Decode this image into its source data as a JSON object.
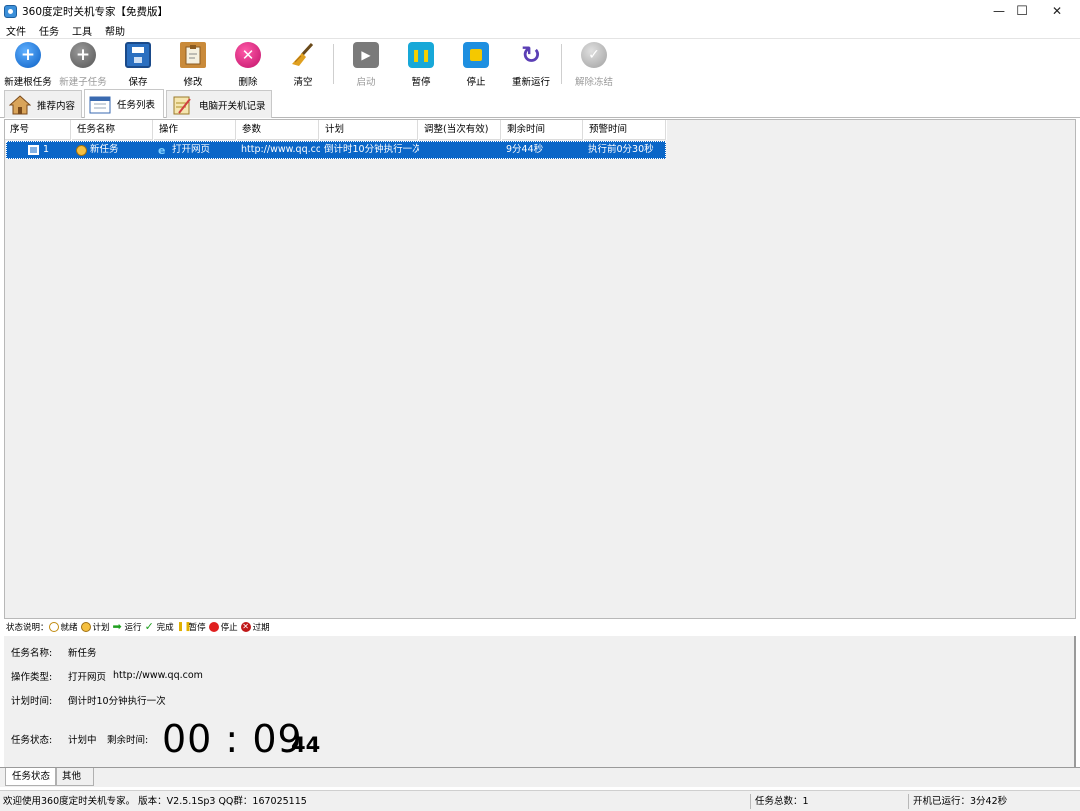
{
  "window": {
    "title": "360度定时关机专家【免费版】",
    "minimize": "—",
    "maximize": "☐",
    "close": "✕"
  },
  "menu": [
    "文件",
    "任务",
    "工具",
    "帮助"
  ],
  "toolbar": {
    "new_root_task": "新建根任务",
    "new_sub_task": "新建子任务",
    "save": "保存",
    "edit": "修改",
    "delete": "删除",
    "clear": "清空",
    "start": "启动",
    "pause": "暂停",
    "stop": "停止",
    "rerun": "重新运行",
    "unfreeze": "解除冻结"
  },
  "tabs": [
    "推荐内容",
    "任务列表",
    "电脑开关机记录"
  ],
  "grid": {
    "columns": [
      "序号",
      "任务名称",
      "操作",
      "参数",
      "计划",
      "调整(当次有效)",
      "剩余时间",
      "预警时间"
    ],
    "rows": [
      {
        "index": "1",
        "name": "新任务",
        "action": "打开网页",
        "param": "http://www.qq.com",
        "plan": "倒计时10分钟执行一次",
        "adjust": "",
        "remaining": "9分44秒",
        "warning": "执行前0分30秒"
      }
    ]
  },
  "legend": {
    "title": "状态说明：",
    "items": [
      "就绪",
      "计划",
      "运行",
      "完成",
      "暂停",
      "停止",
      "过期"
    ]
  },
  "details": {
    "name_label": "任务名称:",
    "name_value": "新任务",
    "type_label": "操作类型:",
    "type_value": "打开网页",
    "type_param": "http://www.qq.com",
    "plan_label": "计划时间:",
    "plan_value": "倒计时10分钟执行一次",
    "status_label": "任务状态:",
    "status_value": "计划中",
    "remaining_label": "剩余时间:",
    "clock": "00 : 09",
    "seconds": "44"
  },
  "bottom_tabs": [
    "任务状态",
    "其他"
  ],
  "statusbar": {
    "welcome": "欢迎使用360度定时关机专家。 版本：V2.5.1Sp3  QQ群：167025115",
    "task_count": "任务总数：1",
    "uptime": "开机已运行：3分42秒"
  },
  "colors": {
    "selection": "#0a66c8",
    "add": "#1a73d9",
    "delete": "#d6237a",
    "pause": "#17a8d8",
    "stop": "#1e8fe0",
    "rerun": "#5b3fb5"
  }
}
